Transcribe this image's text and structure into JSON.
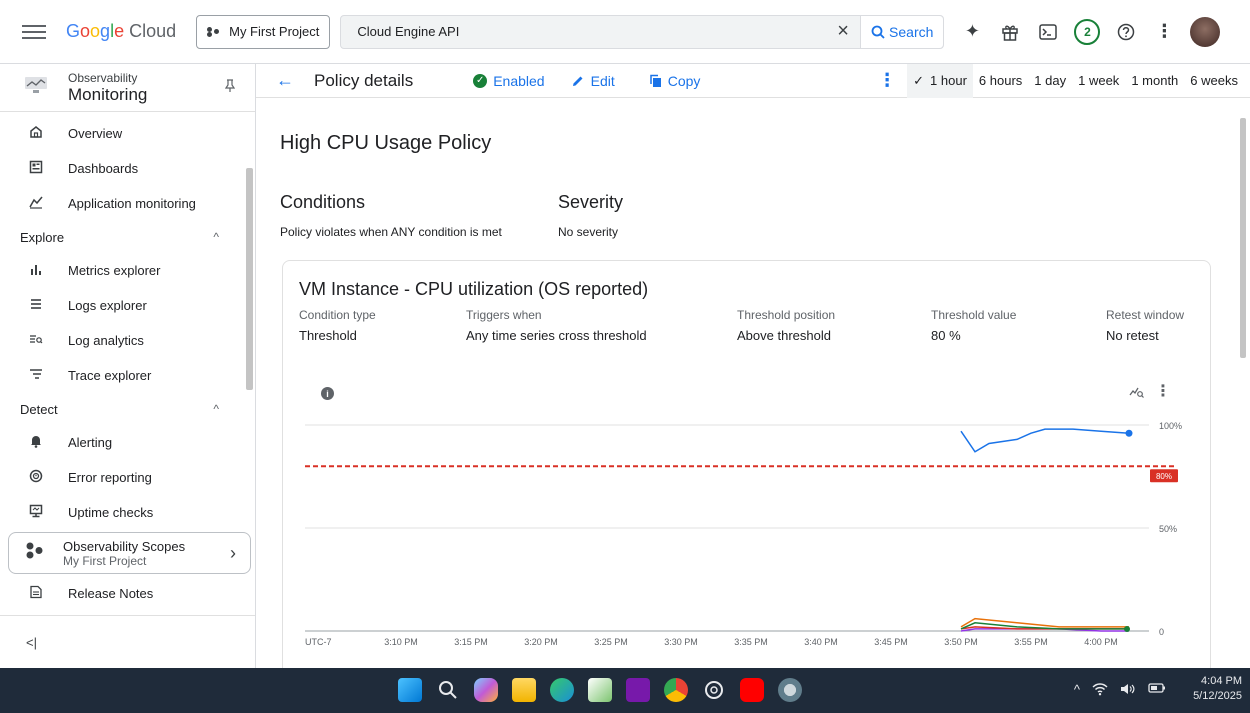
{
  "topbar": {
    "logo_google": [
      "G",
      "o",
      "o",
      "g",
      "l",
      "e"
    ],
    "logo_cloud": "Cloud",
    "project": "My First Project",
    "search_value": "Cloud Engine API",
    "search_button": "Search",
    "notifications_count": "2"
  },
  "sidebar": {
    "product_small": "Observability",
    "product_big": "Monitoring",
    "items_top": [
      {
        "label": "Overview",
        "icon": "home-icon"
      },
      {
        "label": "Dashboards",
        "icon": "dashboard-icon"
      },
      {
        "label": "Application monitoring",
        "icon": "app-monitoring-icon"
      }
    ],
    "explore_label": "Explore",
    "explore_items": [
      {
        "label": "Metrics explorer",
        "icon": "bar-chart-icon"
      },
      {
        "label": "Logs explorer",
        "icon": "list-icon"
      },
      {
        "label": "Log analytics",
        "icon": "log-search-icon"
      },
      {
        "label": "Trace explorer",
        "icon": "trace-icon"
      }
    ],
    "detect_label": "Detect",
    "detect_items": [
      {
        "label": "Alerting",
        "icon": "bell-icon"
      },
      {
        "label": "Error reporting",
        "icon": "error-icon"
      },
      {
        "label": "Uptime checks",
        "icon": "monitor-icon"
      }
    ],
    "scope_title": "Observability Scopes",
    "scope_sub": "My First Project",
    "release_notes": "Release Notes",
    "collapse": "<|"
  },
  "toolbar": {
    "title": "Policy details",
    "enabled": "Enabled",
    "edit": "Edit",
    "copy": "Copy",
    "ranges": [
      "1 hour",
      "6 hours",
      "1 day",
      "1 week",
      "1 month",
      "6 weeks"
    ],
    "selected_range": "1 hour"
  },
  "policy": {
    "name": "High CPU Usage Policy",
    "conditions_label": "Conditions",
    "conditions_text": "Policy violates when ANY condition is met",
    "severity_label": "Severity",
    "severity_text": "No severity"
  },
  "condition": {
    "title": "VM Instance - CPU utilization (OS reported)",
    "fields": [
      {
        "k": "Condition type",
        "v": "Threshold"
      },
      {
        "k": "Triggers when",
        "v": "Any time series cross threshold"
      },
      {
        "k": "Threshold position",
        "v": "Above threshold"
      },
      {
        "k": "Threshold value",
        "v": "80 %"
      },
      {
        "k": "Retest window",
        "v": "No retest"
      }
    ]
  },
  "chart_data": {
    "type": "line",
    "timezone_label": "UTC-7",
    "x_ticks": [
      "3:10 PM",
      "3:15 PM",
      "3:20 PM",
      "3:25 PM",
      "3:30 PM",
      "3:35 PM",
      "3:40 PM",
      "3:45 PM",
      "3:50 PM",
      "3:55 PM",
      "4:00 PM"
    ],
    "y_ticks": [
      "100%",
      "50%",
      "0"
    ],
    "threshold_label": "80%",
    "threshold_value": 80,
    "ylim": [
      0,
      100
    ],
    "series": [
      {
        "color": "#1a73e8",
        "x": [
          "3:50 PM",
          "3:51 PM",
          "3:52 PM",
          "3:54 PM",
          "3:55 PM",
          "3:56 PM",
          "3:58 PM",
          "4:00 PM",
          "4:02 PM"
        ],
        "values": [
          97,
          87,
          91,
          93,
          96,
          98,
          98,
          97,
          96
        ]
      },
      {
        "color": "#e8710a",
        "x": [
          "3:50 PM",
          "3:51 PM",
          "3:54 PM",
          "3:57 PM",
          "4:00 PM",
          "4:02 PM"
        ],
        "values": [
          2,
          6,
          4,
          2,
          2,
          2
        ]
      },
      {
        "color": "#188038",
        "x": [
          "3:50 PM",
          "3:51 PM",
          "3:54 PM",
          "3:57 PM",
          "4:00 PM",
          "4:02 PM"
        ],
        "values": [
          1,
          4,
          2,
          1,
          1,
          1
        ]
      },
      {
        "color": "#d93025",
        "x": [
          "3:50 PM",
          "3:51 PM",
          "3:54 PM",
          "3:57 PM",
          "4:00 PM",
          "4:02 PM"
        ],
        "values": [
          1,
          2,
          1,
          1,
          1,
          1
        ]
      },
      {
        "color": "#9334e6",
        "x": [
          "3:50 PM",
          "3:51 PM",
          "3:54 PM",
          "3:57 PM",
          "4:00 PM",
          "4:02 PM"
        ],
        "values": [
          0,
          1,
          1,
          1,
          0,
          0
        ]
      }
    ]
  },
  "taskbar": {
    "time": "4:04 PM",
    "date": "5/12/2025",
    "apps": [
      "windows-start-icon",
      "search-icon",
      "copilot-icon",
      "file-explorer-icon",
      "edge-icon",
      "app-icon",
      "onenote-icon",
      "chrome-icon",
      "chatgpt-icon",
      "youtube-icon",
      "settings-icon"
    ]
  },
  "colors": {
    "accent": "#1a73e8",
    "threshold": "#d93025",
    "enabled": "#188038"
  }
}
